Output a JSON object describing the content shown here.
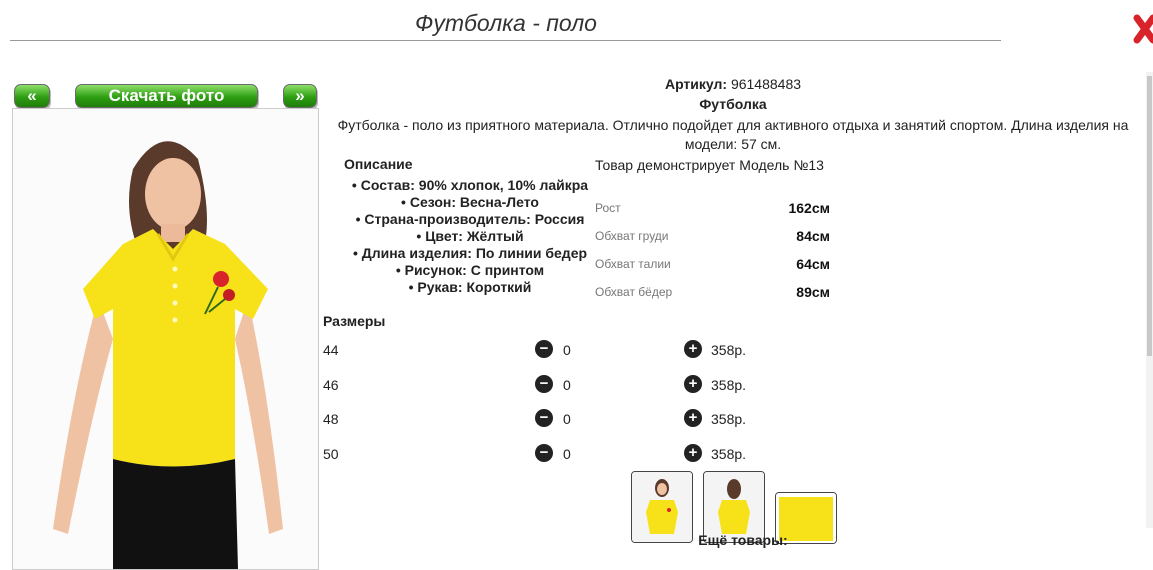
{
  "page": {
    "title": "Футболка - поло"
  },
  "nav": {
    "prev_label": "«",
    "download_label": "Скачать фото",
    "next_label": "»"
  },
  "product": {
    "article_label": "Артикул:",
    "article_value": "961488483",
    "name": "Футболка",
    "description": "Футболка - поло из приятного материала. Отлично подойдет для активного отдыха и занятий спортом. Длина изделия на модели: 57 см."
  },
  "details": {
    "title": "Описание",
    "items": [
      "Состав: 90% хлопок, 10% лайкра",
      "Сезон: Весна-Лето",
      "Страна-производитель: Россия",
      "Цвет: Жёлтый",
      "Длина изделия: По линии бедер",
      "Рисунок: С принтом",
      "Рукав: Короткий"
    ]
  },
  "model": {
    "heading": "Товар демонстрирует Модель №13",
    "measurements": [
      {
        "label": "Рост",
        "value": "162см"
      },
      {
        "label": "Обхват груди",
        "value": "84см"
      },
      {
        "label": "Обхват талии",
        "value": "64см"
      },
      {
        "label": "Обхват бёдер",
        "value": "89см"
      }
    ]
  },
  "sizes": {
    "title": "Размеры",
    "rows": [
      {
        "size": "44",
        "qty": "0",
        "price": "358р."
      },
      {
        "size": "46",
        "qty": "0",
        "price": "358р."
      },
      {
        "size": "48",
        "qty": "0",
        "price": "358р."
      },
      {
        "size": "50",
        "qty": "0",
        "price": "358р."
      }
    ]
  },
  "more": {
    "label": "Ещё товары:"
  },
  "colors": {
    "accent_green": "#2e9e12",
    "shirt_yellow": "#f7e21a",
    "close_red": "#d9232a"
  },
  "icons": {
    "close": "close-icon",
    "minus": "minus-circle-icon",
    "plus": "plus-circle-icon"
  }
}
